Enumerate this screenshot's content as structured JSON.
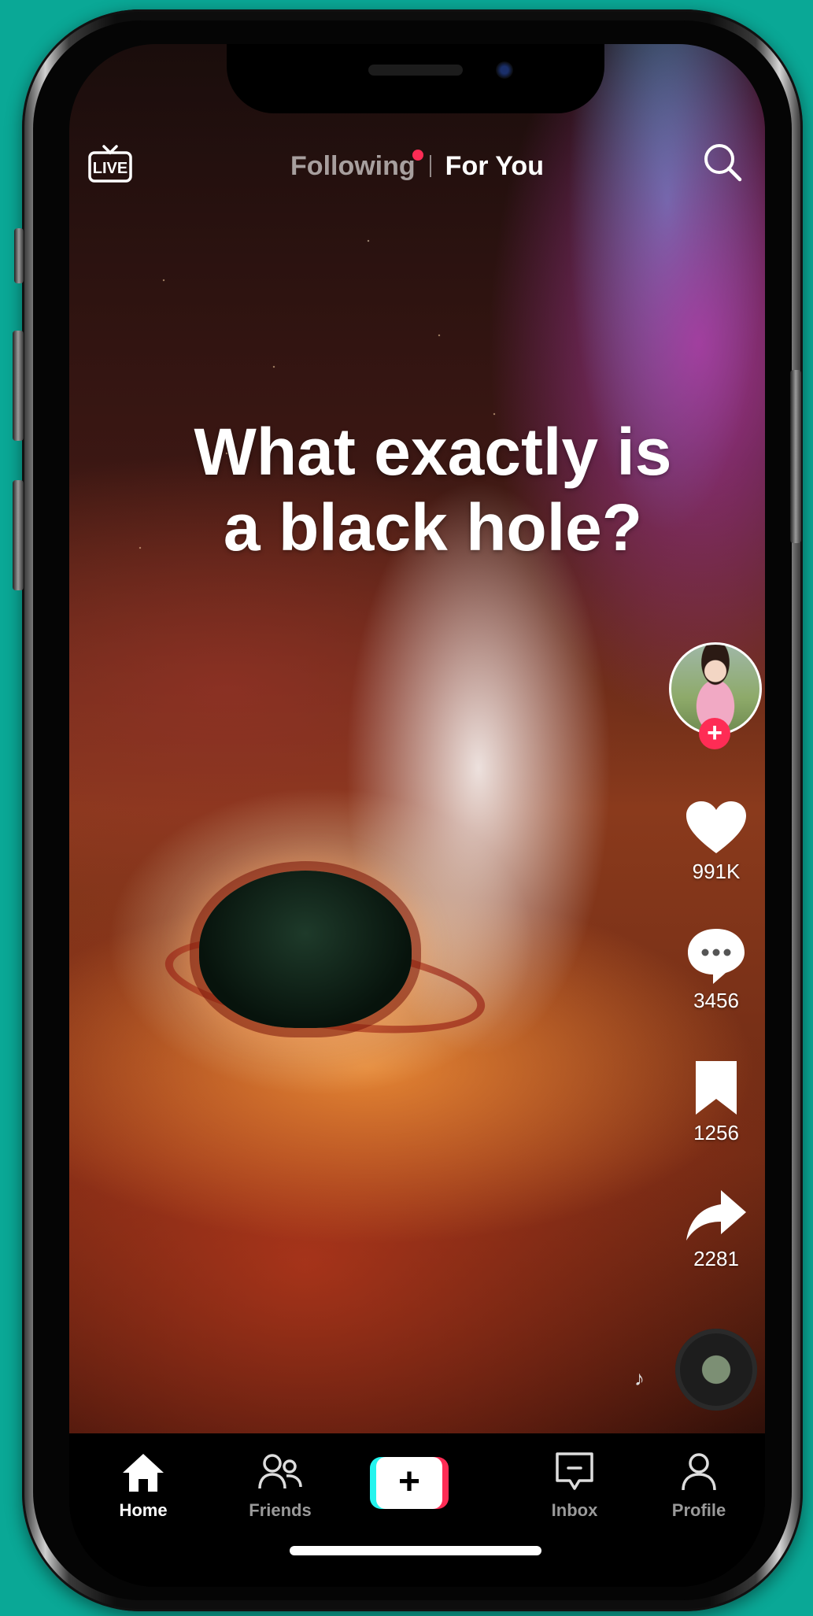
{
  "top_bar": {
    "live_label": "LIVE",
    "tabs": [
      {
        "label": "Following",
        "active": false,
        "has_dot": true
      },
      {
        "label": "For You",
        "active": true
      }
    ]
  },
  "video": {
    "caption_line1": "What exactly is",
    "caption_line2": "a black hole?"
  },
  "actions": {
    "likes": "991K",
    "comments": "3456",
    "saves": "1256",
    "shares": "2281"
  },
  "nav": {
    "items": [
      {
        "label": "Home",
        "active": true
      },
      {
        "label": "Friends",
        "active": false
      },
      {
        "label": "Inbox",
        "active": false
      },
      {
        "label": "Profile",
        "active": false
      }
    ],
    "create_label": "+"
  },
  "colors": {
    "background": "#0aa896",
    "accent_red": "#fe2c55",
    "accent_cyan": "#25f4ee"
  }
}
